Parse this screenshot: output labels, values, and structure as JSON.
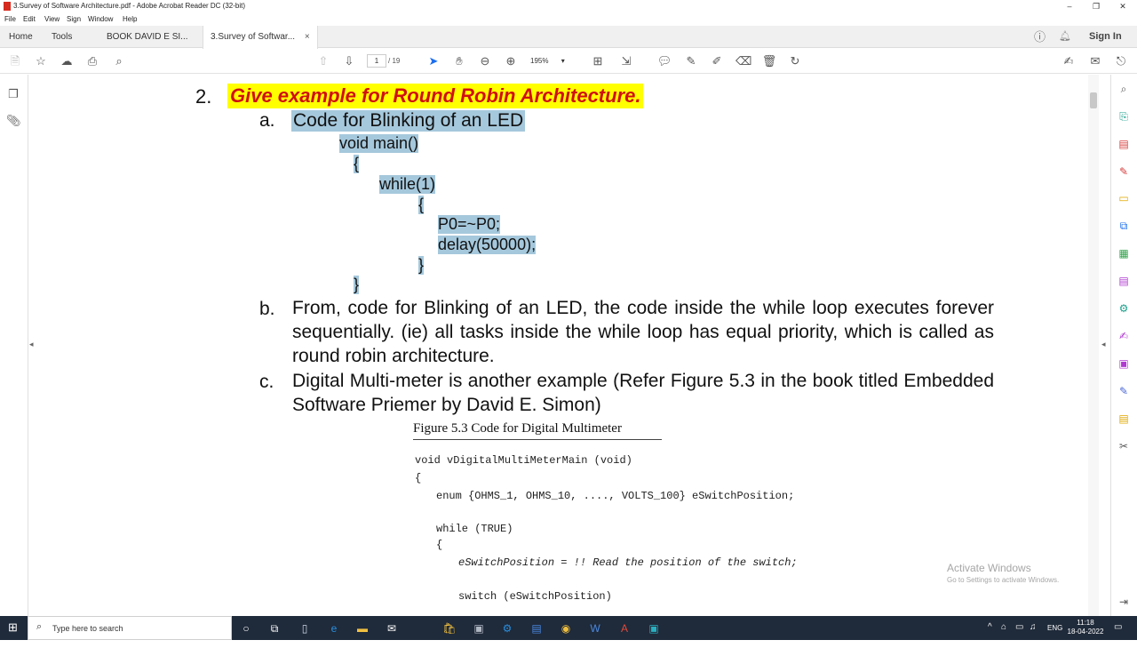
{
  "window": {
    "title": "3.Survey of Software Architecture.pdf - Adobe Acrobat Reader DC (32-bit)",
    "controls": [
      "–",
      "❐",
      "✕"
    ]
  },
  "menu": [
    "File",
    "Edit",
    "View",
    "Sign",
    "Window",
    "Help"
  ],
  "tabs": {
    "home": "Home",
    "tools": "Tools",
    "doc1": "BOOK DAVID E SI...",
    "doc2": "3.Survey of Softwar...",
    "close": "×",
    "sign_in": "Sign In"
  },
  "toolbar": {
    "page_current": "1",
    "page_total": "/ 19",
    "zoom": "195%"
  },
  "document": {
    "heading_number": "2.",
    "heading": "Give example for Round Robin Architecture.",
    "item_a_marker": "a.",
    "item_a_title": "Code for Blinking of an LED",
    "code": [
      "void main()",
      "{",
      "while(1)",
      "{",
      "P0=~P0;",
      "delay(50000);",
      "}",
      "}"
    ],
    "item_b_marker": "b.",
    "item_b_text": "From, code for Blinking of an LED, the code inside the while loop executes forever sequentially. (ie) all tasks inside the while loop has equal priority, which is called as round robin architecture.",
    "item_c_marker": "c.",
    "item_c_text": "Digital Multi-meter is another example (Refer Figure 5.3 in the book titled Embedded Software Priemer by David E. Simon)",
    "figure_caption": "Figure 5.3   Code for Digital Multimeter",
    "figure_code": [
      "void vDigitalMultiMeterMain (void)",
      "{",
      "enum {OHMS_1, OHMS_10, ...., VOLTS_100} eSwitchPosition;",
      "while (TRUE)",
      "{",
      "eSwitchPosition = !! Read the position of the switch;",
      "switch (eSwitchPosition)"
    ]
  },
  "watermark": {
    "line1": "Activate Windows",
    "line2": "Go to Settings to activate Windows."
  },
  "taskbar": {
    "search_placeholder": "Type here to search",
    "lang": "ENG",
    "time": "11:18",
    "date": "18-04-2022"
  },
  "colors": {
    "heading_red": "#d01010",
    "highlight_yellow": "#ffff00",
    "selection_blue": "#a5c8dc",
    "taskbar": "#1f2a3a"
  }
}
